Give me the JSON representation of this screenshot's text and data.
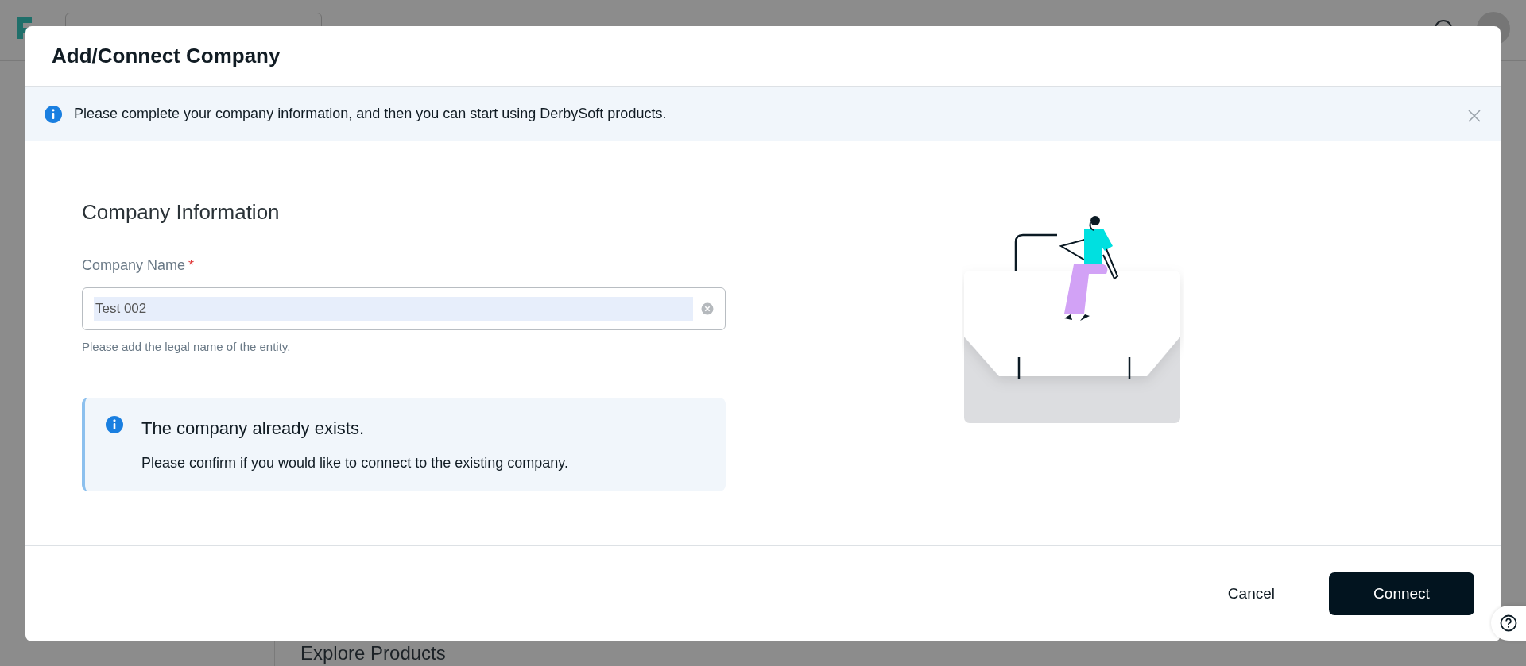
{
  "background": {
    "section_title": "Explore Products"
  },
  "dialog": {
    "title": "Add/Connect Company",
    "banner": {
      "text": "Please complete your company information, and then you can start using DerbySoft products.",
      "dismissible": true
    },
    "section_title": "Company Information",
    "field": {
      "label": "Company Name",
      "required": true,
      "required_mark": "*",
      "value": "Test 002",
      "selected": true,
      "hint": "Please add the legal name of the entity."
    },
    "alert": {
      "title": "The company already exists.",
      "text": "Please confirm if you would like to connect to the existing company."
    },
    "buttons": [
      {
        "label": "Cancel",
        "kind": "text"
      },
      {
        "label": "Connect",
        "kind": "primary"
      }
    ]
  }
}
